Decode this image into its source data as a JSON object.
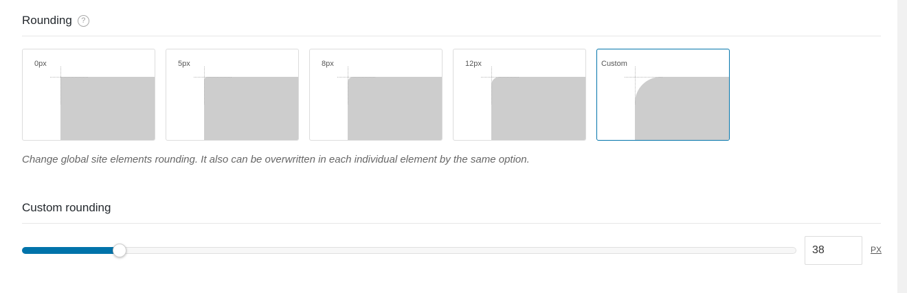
{
  "rounding": {
    "title": "Rounding",
    "help_icon": "question-circle-icon",
    "options": [
      {
        "label": "0px",
        "radius": 0,
        "selected": false
      },
      {
        "label": "5px",
        "radius": 5,
        "selected": false
      },
      {
        "label": "8px",
        "radius": 8,
        "selected": false
      },
      {
        "label": "12px",
        "radius": 12,
        "selected": false
      },
      {
        "label": "Custom",
        "radius": 38,
        "selected": true
      }
    ],
    "description": "Change global site elements rounding. It also can be overwritten in each individual element by the same option."
  },
  "custom_rounding": {
    "title": "Custom rounding",
    "value": "38",
    "unit": "PX",
    "slider_fraction": 0.126
  },
  "colors": {
    "accent": "#0073aa",
    "shape": "#cdcdcd"
  }
}
